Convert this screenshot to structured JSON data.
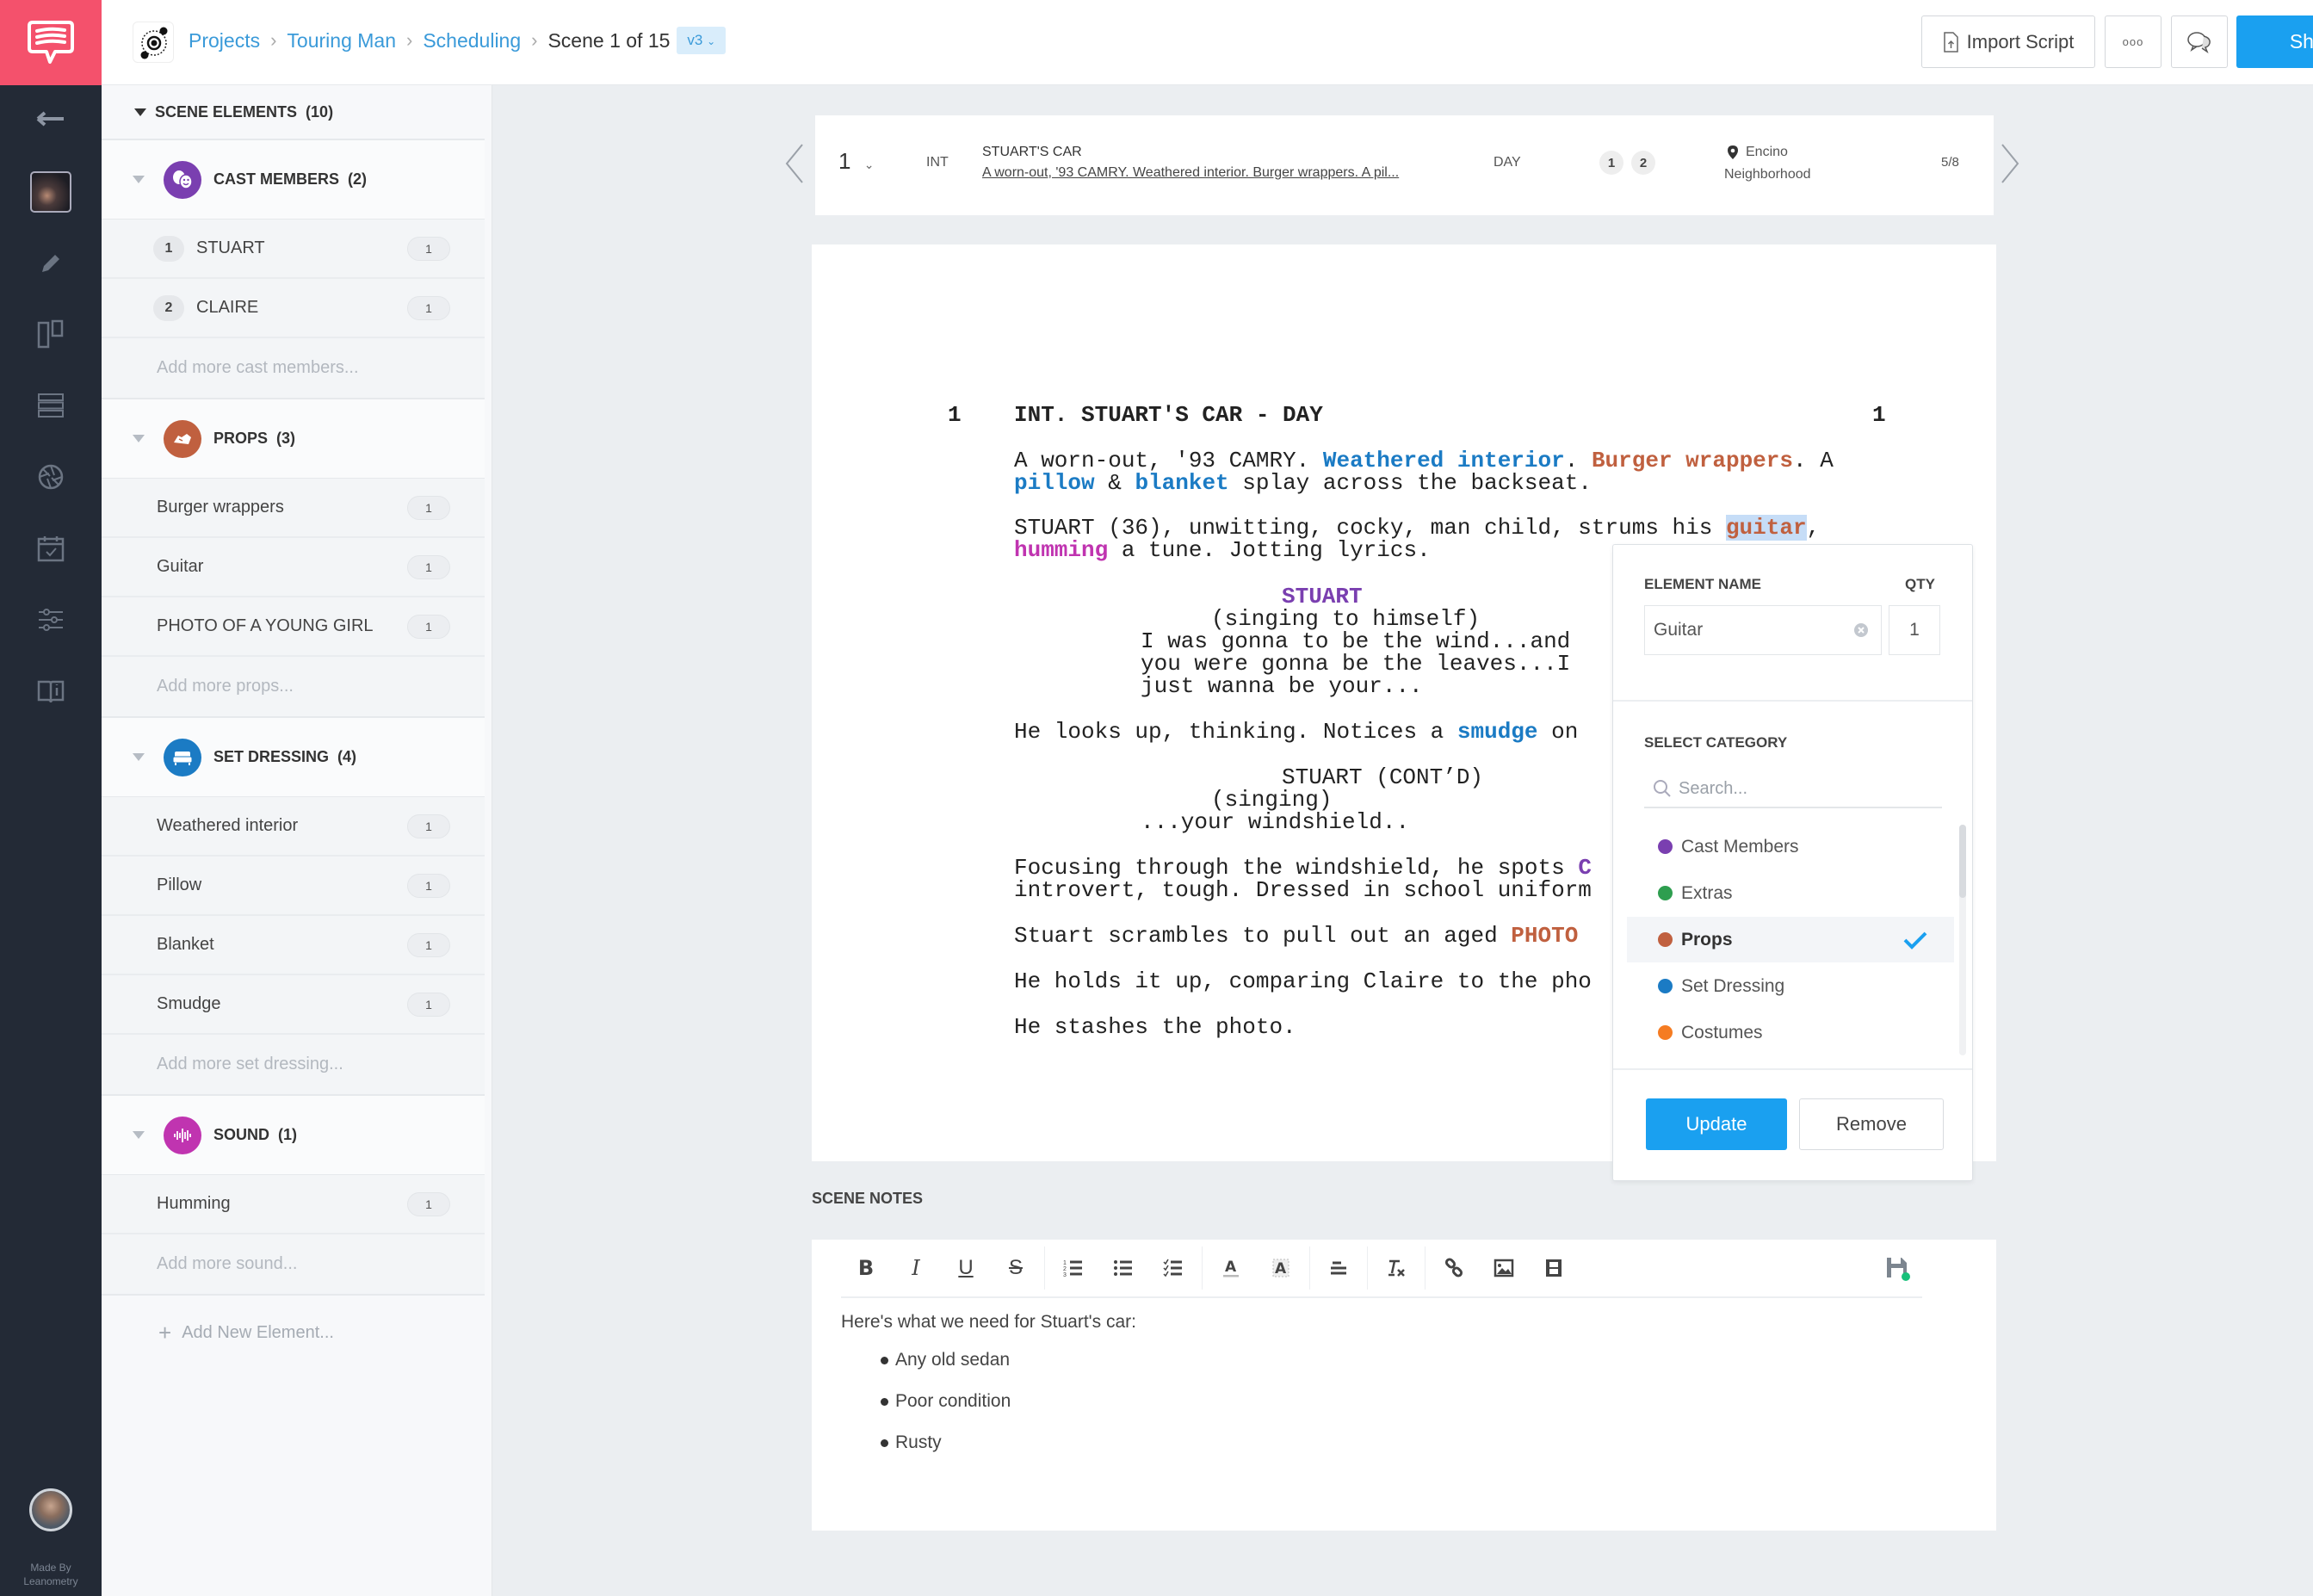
{
  "app": {
    "made_by_line1": "Made By",
    "made_by_line2": "Leanometry"
  },
  "breadcrumb": {
    "items": [
      "Projects",
      "Touring Man",
      "Scheduling"
    ],
    "current": "Scene 1 of 15",
    "version": "v3"
  },
  "toolbar": {
    "import_label": "Import Script",
    "more_label": "ooo",
    "share_label": "Share"
  },
  "colors": {
    "brand": "#f4516c",
    "accent": "#1aa0f0",
    "cast": "#7a3fb0",
    "extras": "#2e9e4f",
    "props": "#c0603f",
    "set_dressing": "#1b7bc4",
    "costumes": "#f57c22",
    "sound": "#c034b0"
  },
  "panel": {
    "title": "SCENE ELEMENTS",
    "count": "(10)",
    "categories": [
      {
        "label": "CAST MEMBERS",
        "count": "(2)",
        "icon": "theater-masks-icon",
        "items": [
          {
            "num": "1",
            "name": "STUART",
            "qty": "1"
          },
          {
            "num": "2",
            "name": "CLAIRE",
            "qty": "1"
          }
        ],
        "add_placeholder": "Add more cast members..."
      },
      {
        "label": "PROPS",
        "count": "(3)",
        "icon": "hand-prop-icon",
        "items": [
          {
            "name": "Burger wrappers",
            "qty": "1"
          },
          {
            "name": "Guitar",
            "qty": "1"
          },
          {
            "name": "PHOTO OF A YOUNG GIRL",
            "qty": "1"
          }
        ],
        "add_placeholder": "Add more props..."
      },
      {
        "label": "SET DRESSING",
        "count": "(4)",
        "icon": "sofa-icon",
        "items": [
          {
            "name": "Weathered interior",
            "qty": "1"
          },
          {
            "name": "Pillow",
            "qty": "1"
          },
          {
            "name": "Blanket",
            "qty": "1"
          },
          {
            "name": "Smudge",
            "qty": "1"
          }
        ],
        "add_placeholder": "Add more set dressing..."
      },
      {
        "label": "SOUND",
        "count": "(1)",
        "icon": "sound-wave-icon",
        "items": [
          {
            "name": "Humming",
            "qty": "1"
          }
        ],
        "add_placeholder": "Add more sound..."
      }
    ],
    "add_new": "Add New Element..."
  },
  "scene": {
    "number": "1",
    "int_ext": "INT",
    "location": "STUART'S CAR",
    "synopsis": "A worn-out, '93 CAMRY. Weathered interior. Burger wrappers. A pil...",
    "time": "DAY",
    "cast_ids": [
      "1",
      "2"
    ],
    "shoot_location_line1": "Encino",
    "shoot_location_line2": "Neighborhood",
    "page_length": "5/8"
  },
  "script": {
    "scene_num": "1",
    "heading": "INT. STUART'S CAR - DAY",
    "p1": {
      "a": "A worn-out, '93 CAMRY. ",
      "b": "Weathered interior",
      "c": ". ",
      "d": "Burger wrappers",
      "e": ". A",
      "f": "pillow",
      "g": " & ",
      "h": "blanket",
      "i": " splay across the backseat."
    },
    "p2": {
      "a": "STUART (36), unwitting, cocky, man child, strums his ",
      "b": "guitar",
      "c": ",",
      "d": "humming",
      "e": " a tune. Jotting lyrics."
    },
    "dialogue1": {
      "character": "STUART",
      "paren": "(singing to himself)",
      "lines": [
        "I was gonna to be the wind...and",
        "you were gonna be the leaves...I",
        "just wanna be your..."
      ]
    },
    "p3": {
      "a": "He looks up, thinking. Notices a ",
      "b": "smudge",
      "c": " on"
    },
    "dialogue2": {
      "character": "STUART (CONT’D)",
      "paren": "(singing)",
      "line": "...your windshield.."
    },
    "p4": {
      "a": "Focusing through the windshield, he spots ",
      "b": "C",
      "c": "introvert, tough. Dressed in school uniform"
    },
    "p5": {
      "a": "Stuart scrambles to pull out an aged ",
      "b": "PHOTO"
    },
    "p6": "He holds it up, comparing Claire to the pho",
    "p7": "He stashes the photo."
  },
  "popover": {
    "name_label": "ELEMENT NAME",
    "qty_label": "QTY",
    "name_value": "Guitar",
    "qty_value": "1",
    "category_label": "SELECT CATEGORY",
    "search_placeholder": "Search...",
    "categories": [
      {
        "label": "Cast Members",
        "color": "#7a3fb0",
        "selected": false
      },
      {
        "label": "Extras",
        "color": "#2e9e4f",
        "selected": false
      },
      {
        "label": "Props",
        "color": "#c0603f",
        "selected": true
      },
      {
        "label": "Set Dressing",
        "color": "#1b7bc4",
        "selected": false
      },
      {
        "label": "Costumes",
        "color": "#f57c22",
        "selected": false
      }
    ],
    "update_label": "Update",
    "remove_label": "Remove"
  },
  "notes": {
    "title": "SCENE NOTES",
    "intro": "Here's what we need for Stuart's car:",
    "bullets": [
      "Any old sedan",
      "Poor condition",
      "Rusty"
    ]
  }
}
